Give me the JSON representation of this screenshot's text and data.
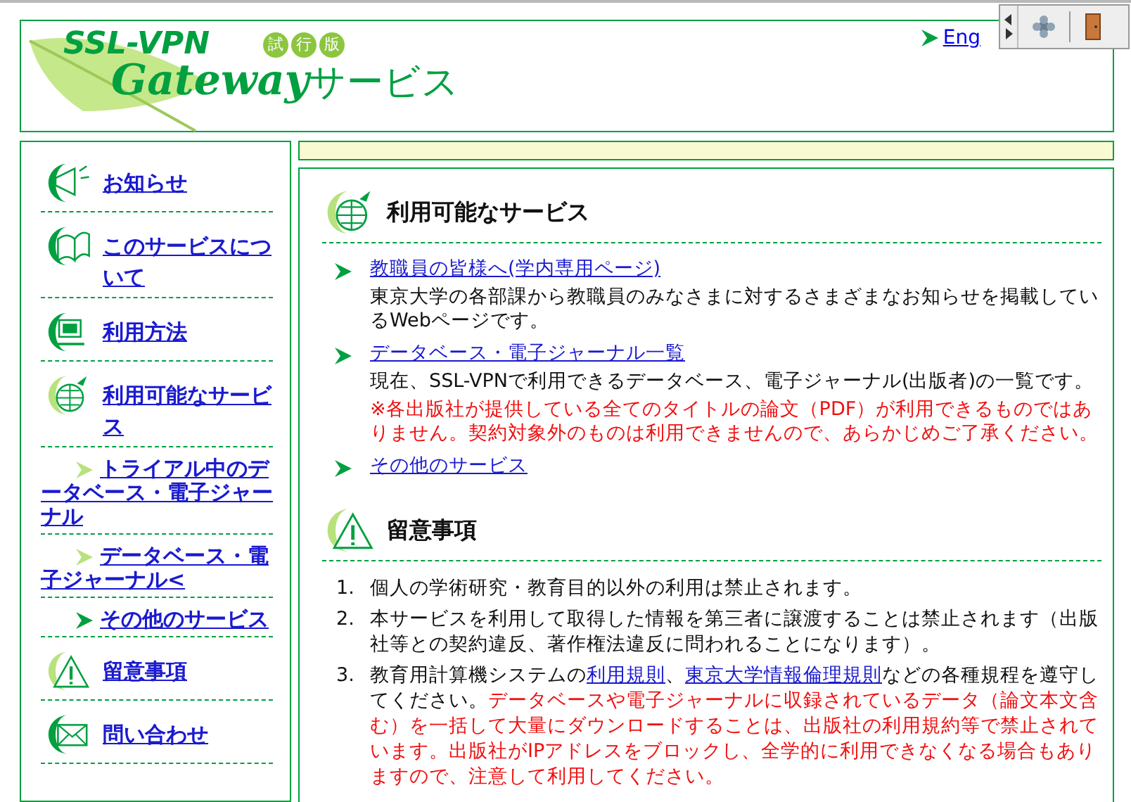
{
  "header": {
    "logo": {
      "line1": "SSL-VPN",
      "badge": [
        "試",
        "行",
        "版"
      ],
      "name": "Gateway",
      "suffix": "サービス"
    },
    "language_link": "Eng"
  },
  "sidebar": {
    "items": [
      {
        "kind": "main",
        "label": "お知らせ"
      },
      {
        "kind": "main",
        "label": "このサービスについて"
      },
      {
        "kind": "main",
        "label": "利用方法"
      },
      {
        "kind": "main",
        "label": "利用可能なサービス"
      },
      {
        "kind": "sub",
        "color": "#b8e27c",
        "label": "トライアル中のデータベース・電子ジャーナル"
      },
      {
        "kind": "sub",
        "color": "#b8e27c",
        "label": "データベース・電子ジャーナル<"
      },
      {
        "kind": "sub",
        "color": "#00a040",
        "label": "その他のサービス"
      },
      {
        "kind": "main",
        "label": "留意事項"
      },
      {
        "kind": "main",
        "label": "問い合わせ"
      }
    ]
  },
  "content": {
    "sections": [
      {
        "kind": "links",
        "title": "利用可能なサービス",
        "items": [
          {
            "link": "教職員の皆様へ(学内専用ページ)",
            "description": "東京大学の各部課から教職員のみなさまに対するさまざまなお知らせを掲載しているWebページです。"
          },
          {
            "link": "データベース・電子ジャーナル一覧",
            "description": "現在、SSL-VPNで利用できるデータベース、電子ジャーナル(出版者)の一覧です。",
            "note": "※各出版社が提供している全てのタイトルの論文（PDF）が利用できるものではありません。契約対象外のものは利用できませんので、あらかじめご了承ください。"
          },
          {
            "link": "その他のサービス"
          }
        ]
      },
      {
        "kind": "numbered",
        "title": "留意事項",
        "items": [
          {
            "number": "1.",
            "parts": [
              {
                "kind": "text",
                "text": "個人の学術研究・教育目的以外の利用は禁止されます。"
              }
            ]
          },
          {
            "number": "2.",
            "parts": [
              {
                "kind": "text",
                "text": "本サービスを利用して取得した情報を第三者に譲渡することは禁止されます（出版社等との契約違反、著作権法違反に問われることになります）。"
              }
            ]
          },
          {
            "number": "3.",
            "parts": [
              {
                "kind": "text",
                "text": "教育用計算機システムの"
              },
              {
                "kind": "link",
                "text": "利用規則"
              },
              {
                "kind": "text",
                "text": "、"
              },
              {
                "kind": "link",
                "text": "東京大学情報倫理規則"
              },
              {
                "kind": "text",
                "text": "などの各種規程を遵守してください。"
              },
              {
                "kind": "warning",
                "text": "データベースや電子ジャーナルに収録されているデータ（論文本文含む）を一括して大量にダウンロードすることは、出版社の利用規約等で禁止されています。出版社がIPアドレスをブロックし、全学的に利用できなくなる場合もありますので、注意して利用してください。"
              }
            ]
          }
        ]
      }
    ]
  }
}
